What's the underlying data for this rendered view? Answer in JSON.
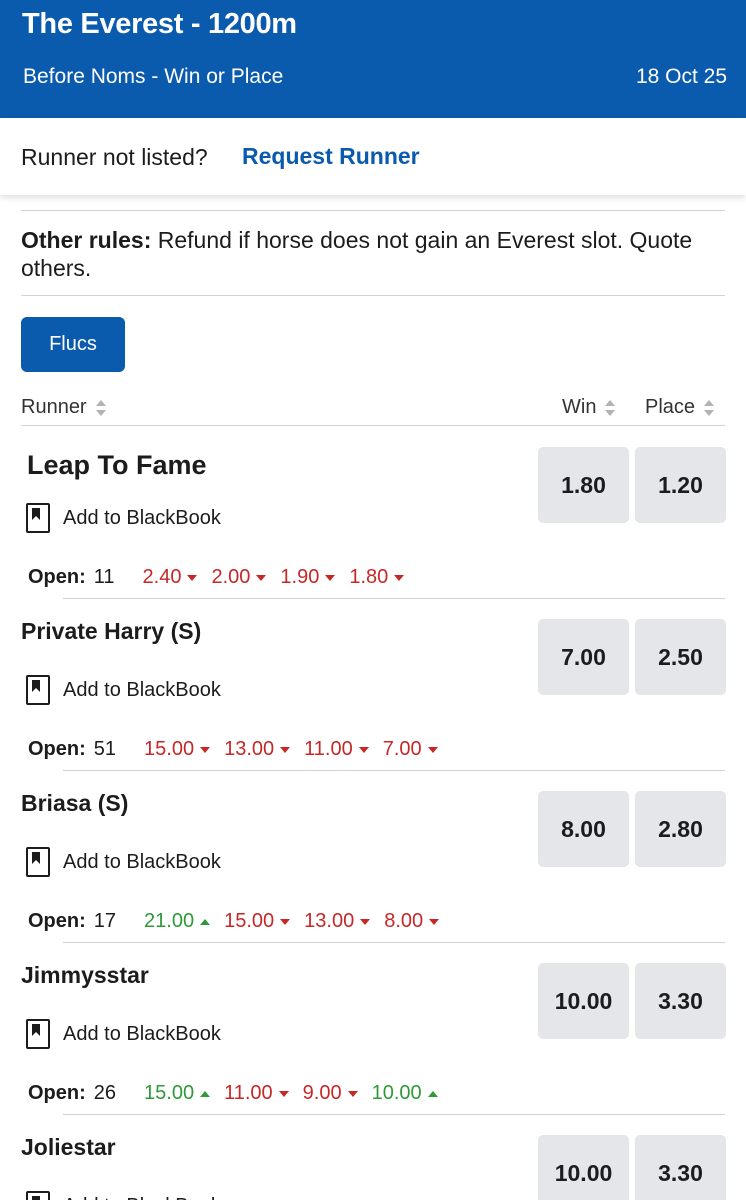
{
  "header": {
    "title": "The Everest - 1200m",
    "market": "Before Noms - Win or Place",
    "date": "18 Oct 25",
    "bg_color": "#0a5aad"
  },
  "request": {
    "question": "Runner not listed?",
    "link_label": "Request Runner"
  },
  "rules": {
    "label": "Other rules:",
    "text": " Refund if horse does not gain an Everest slot. Quote others."
  },
  "flucs_button": "Flucs",
  "columns": {
    "runner": "Runner",
    "win": "Win",
    "place": "Place"
  },
  "blackbook_label": "Add to BlackBook",
  "open_label": "Open:",
  "runners": [
    {
      "name": "Leap To Fame",
      "win": "1.80",
      "place": "1.20",
      "open": "11",
      "flucs": [
        {
          "value": "2.40",
          "dir": "down"
        },
        {
          "value": "2.00",
          "dir": "down"
        },
        {
          "value": "1.90",
          "dir": "down"
        },
        {
          "value": "1.80",
          "dir": "down"
        }
      ]
    },
    {
      "name": "Private Harry (S)",
      "win": "7.00",
      "place": "2.50",
      "open": "51",
      "flucs": [
        {
          "value": "15.00",
          "dir": "down"
        },
        {
          "value": "13.00",
          "dir": "down"
        },
        {
          "value": "11.00",
          "dir": "down"
        },
        {
          "value": "7.00",
          "dir": "down"
        }
      ]
    },
    {
      "name": "Briasa (S)",
      "win": "8.00",
      "place": "2.80",
      "open": "17",
      "flucs": [
        {
          "value": "21.00",
          "dir": "up"
        },
        {
          "value": "15.00",
          "dir": "down"
        },
        {
          "value": "13.00",
          "dir": "down"
        },
        {
          "value": "8.00",
          "dir": "down"
        }
      ]
    },
    {
      "name": "Jimmysstar",
      "win": "10.00",
      "place": "3.30",
      "open": "26",
      "flucs": [
        {
          "value": "15.00",
          "dir": "up"
        },
        {
          "value": "11.00",
          "dir": "down"
        },
        {
          "value": "9.00",
          "dir": "down"
        },
        {
          "value": "10.00",
          "dir": "up"
        }
      ]
    },
    {
      "name": "Joliestar",
      "win": "10.00",
      "place": "3.30"
    }
  ]
}
